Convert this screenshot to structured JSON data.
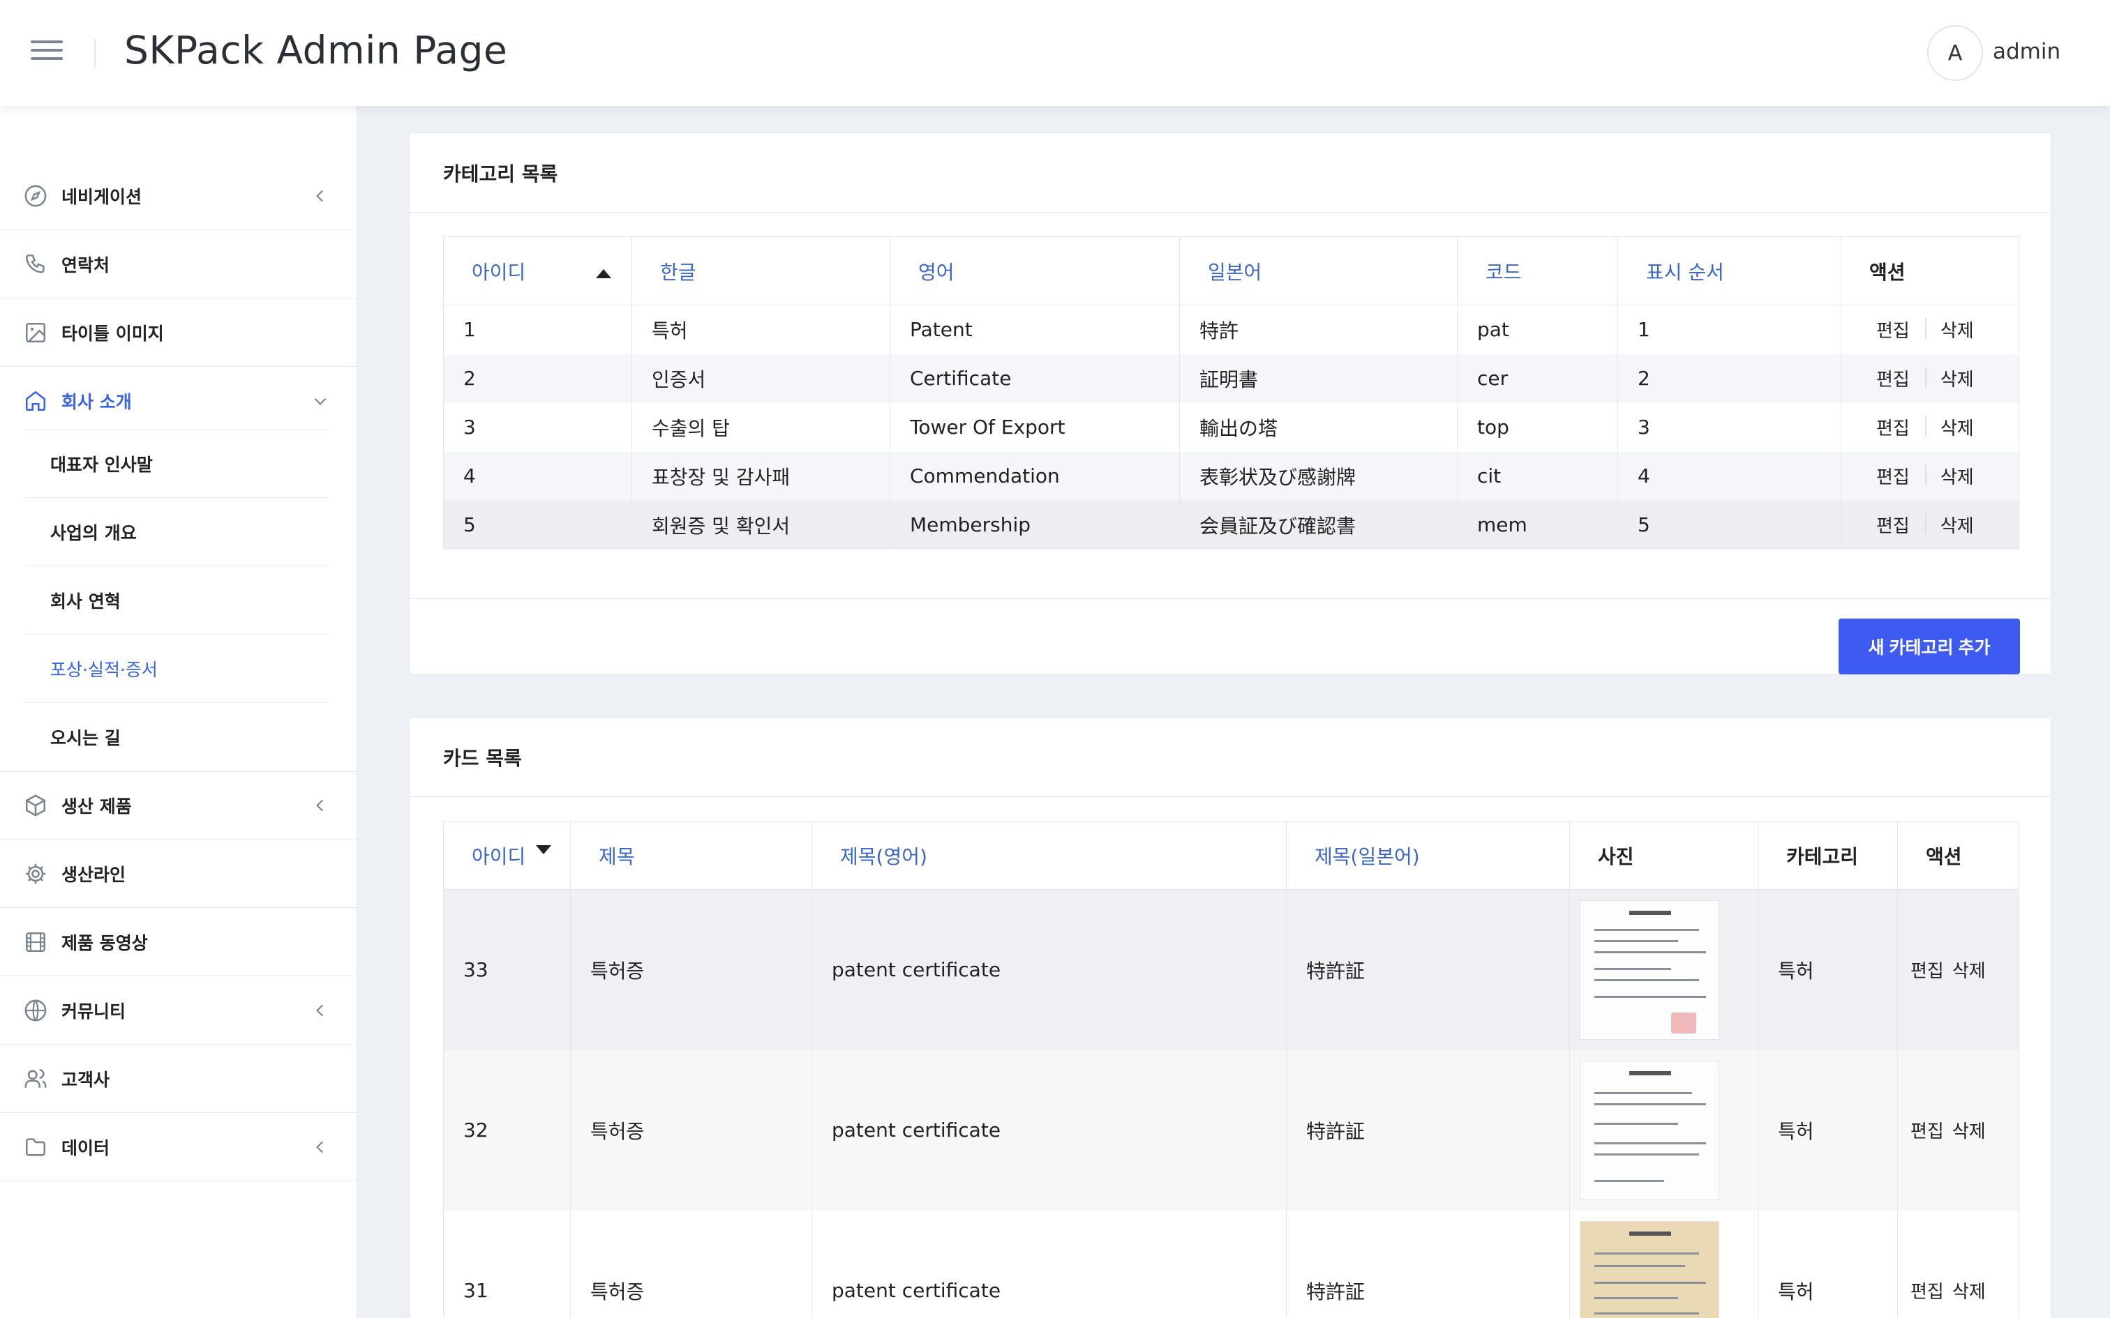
{
  "header": {
    "title": "SKPack Admin Page",
    "avatar_initial": "A",
    "user": "admin"
  },
  "sidebar": {
    "items": [
      {
        "label": "네비게이션",
        "icon": "compass-icon",
        "chevron": "left"
      },
      {
        "label": "연락처",
        "icon": "phone-icon"
      },
      {
        "label": "타이틀 이미지",
        "icon": "image-icon"
      },
      {
        "label": "회사 소개",
        "icon": "home-icon",
        "chevron": "down",
        "active": true
      },
      {
        "label": "생산 제품",
        "icon": "box-icon",
        "chevron": "left"
      },
      {
        "label": "생산라인",
        "icon": "gear-icon"
      },
      {
        "label": "제품 동영상",
        "icon": "film-icon"
      },
      {
        "label": "커뮤니티",
        "icon": "globe-icon",
        "chevron": "left"
      },
      {
        "label": "고객사",
        "icon": "users-icon"
      },
      {
        "label": "데이터",
        "icon": "folder-icon",
        "chevron": "left"
      }
    ],
    "subitems": [
      {
        "label": "대표자 인사말"
      },
      {
        "label": "사업의 개요"
      },
      {
        "label": "회사 연혁"
      },
      {
        "label": "포상·실적·증서",
        "active": true
      },
      {
        "label": "오시는 길"
      }
    ]
  },
  "category_card": {
    "title": "카테고리 목록",
    "columns": [
      "아이디",
      "한글",
      "영어",
      "일본어",
      "코드",
      "표시 순서",
      "액션"
    ],
    "rows": [
      [
        "1",
        "특허",
        "Patent",
        "特許",
        "pat",
        "1"
      ],
      [
        "2",
        "인증서",
        "Certificate",
        "証明書",
        "cer",
        "2"
      ],
      [
        "3",
        "수출의 탑",
        "Tower Of Export",
        "輸出の塔",
        "top",
        "3"
      ],
      [
        "4",
        "표창장 및 감사패",
        "Commendation",
        "表彰状及び感謝牌",
        "cit",
        "4"
      ],
      [
        "5",
        "회원증 및 확인서",
        "Membership",
        "会員証及び確認書",
        "mem",
        "5"
      ]
    ],
    "edit_label": "편집",
    "delete_label": "삭제",
    "add_button": "새 카테고리 추가"
  },
  "card_list": {
    "title": "카드 목록",
    "columns": [
      "아이디",
      "제목",
      "제목(영어)",
      "제목(일본어)",
      "사진",
      "카테고리",
      "액션"
    ],
    "rows": [
      [
        "33",
        "특허증",
        "patent certificate",
        "特許証",
        "특허"
      ],
      [
        "32",
        "특허증",
        "patent certificate",
        "特許証",
        "특허"
      ],
      [
        "31",
        "특허증",
        "patent certificate",
        "特許証",
        "특허"
      ]
    ],
    "edit_label": "편집",
    "delete_label": "삭제"
  },
  "colors": {
    "accent": "#3563e9",
    "button": "#3d5af1",
    "header_link": "#3a66c8"
  }
}
